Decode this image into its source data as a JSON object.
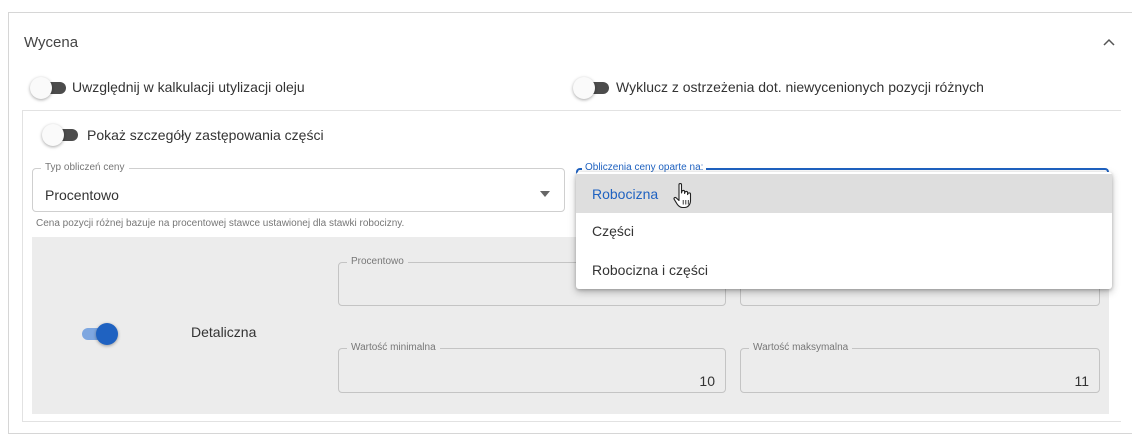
{
  "section": {
    "title": "Wycena"
  },
  "toggles": {
    "oil": {
      "label": "Uwzględnij w kalkulacji utylizacji oleju",
      "on": false
    },
    "exclude": {
      "label": "Wyklucz z ostrzeżenia dot. niewycenionych pozycji różnych",
      "on": false
    },
    "details": {
      "label": "Pokaż szczegóły zastępowania części",
      "on": false
    },
    "retail": {
      "on": true
    }
  },
  "price_type": {
    "label": "Typ obliczeń ceny",
    "value": "Procentowo",
    "helper": "Cena pozycji różnej bazuje na procentowej stawce ustawionej dla stawki robocizny."
  },
  "based_on": {
    "label": "Obliczenia ceny oparte na:",
    "options": [
      "Robocizna",
      "Części",
      "Robocizna i części"
    ],
    "selected": "Robocizna"
  },
  "retail": {
    "label": "Detaliczna",
    "percent_label": "Procentowo",
    "min_label": "Wartość minimalna",
    "min_value": "10",
    "max_label": "Wartość maksymalna",
    "max_value": "11"
  },
  "colors": {
    "accent": "#1f62c1",
    "grey_panel": "#ececec"
  }
}
